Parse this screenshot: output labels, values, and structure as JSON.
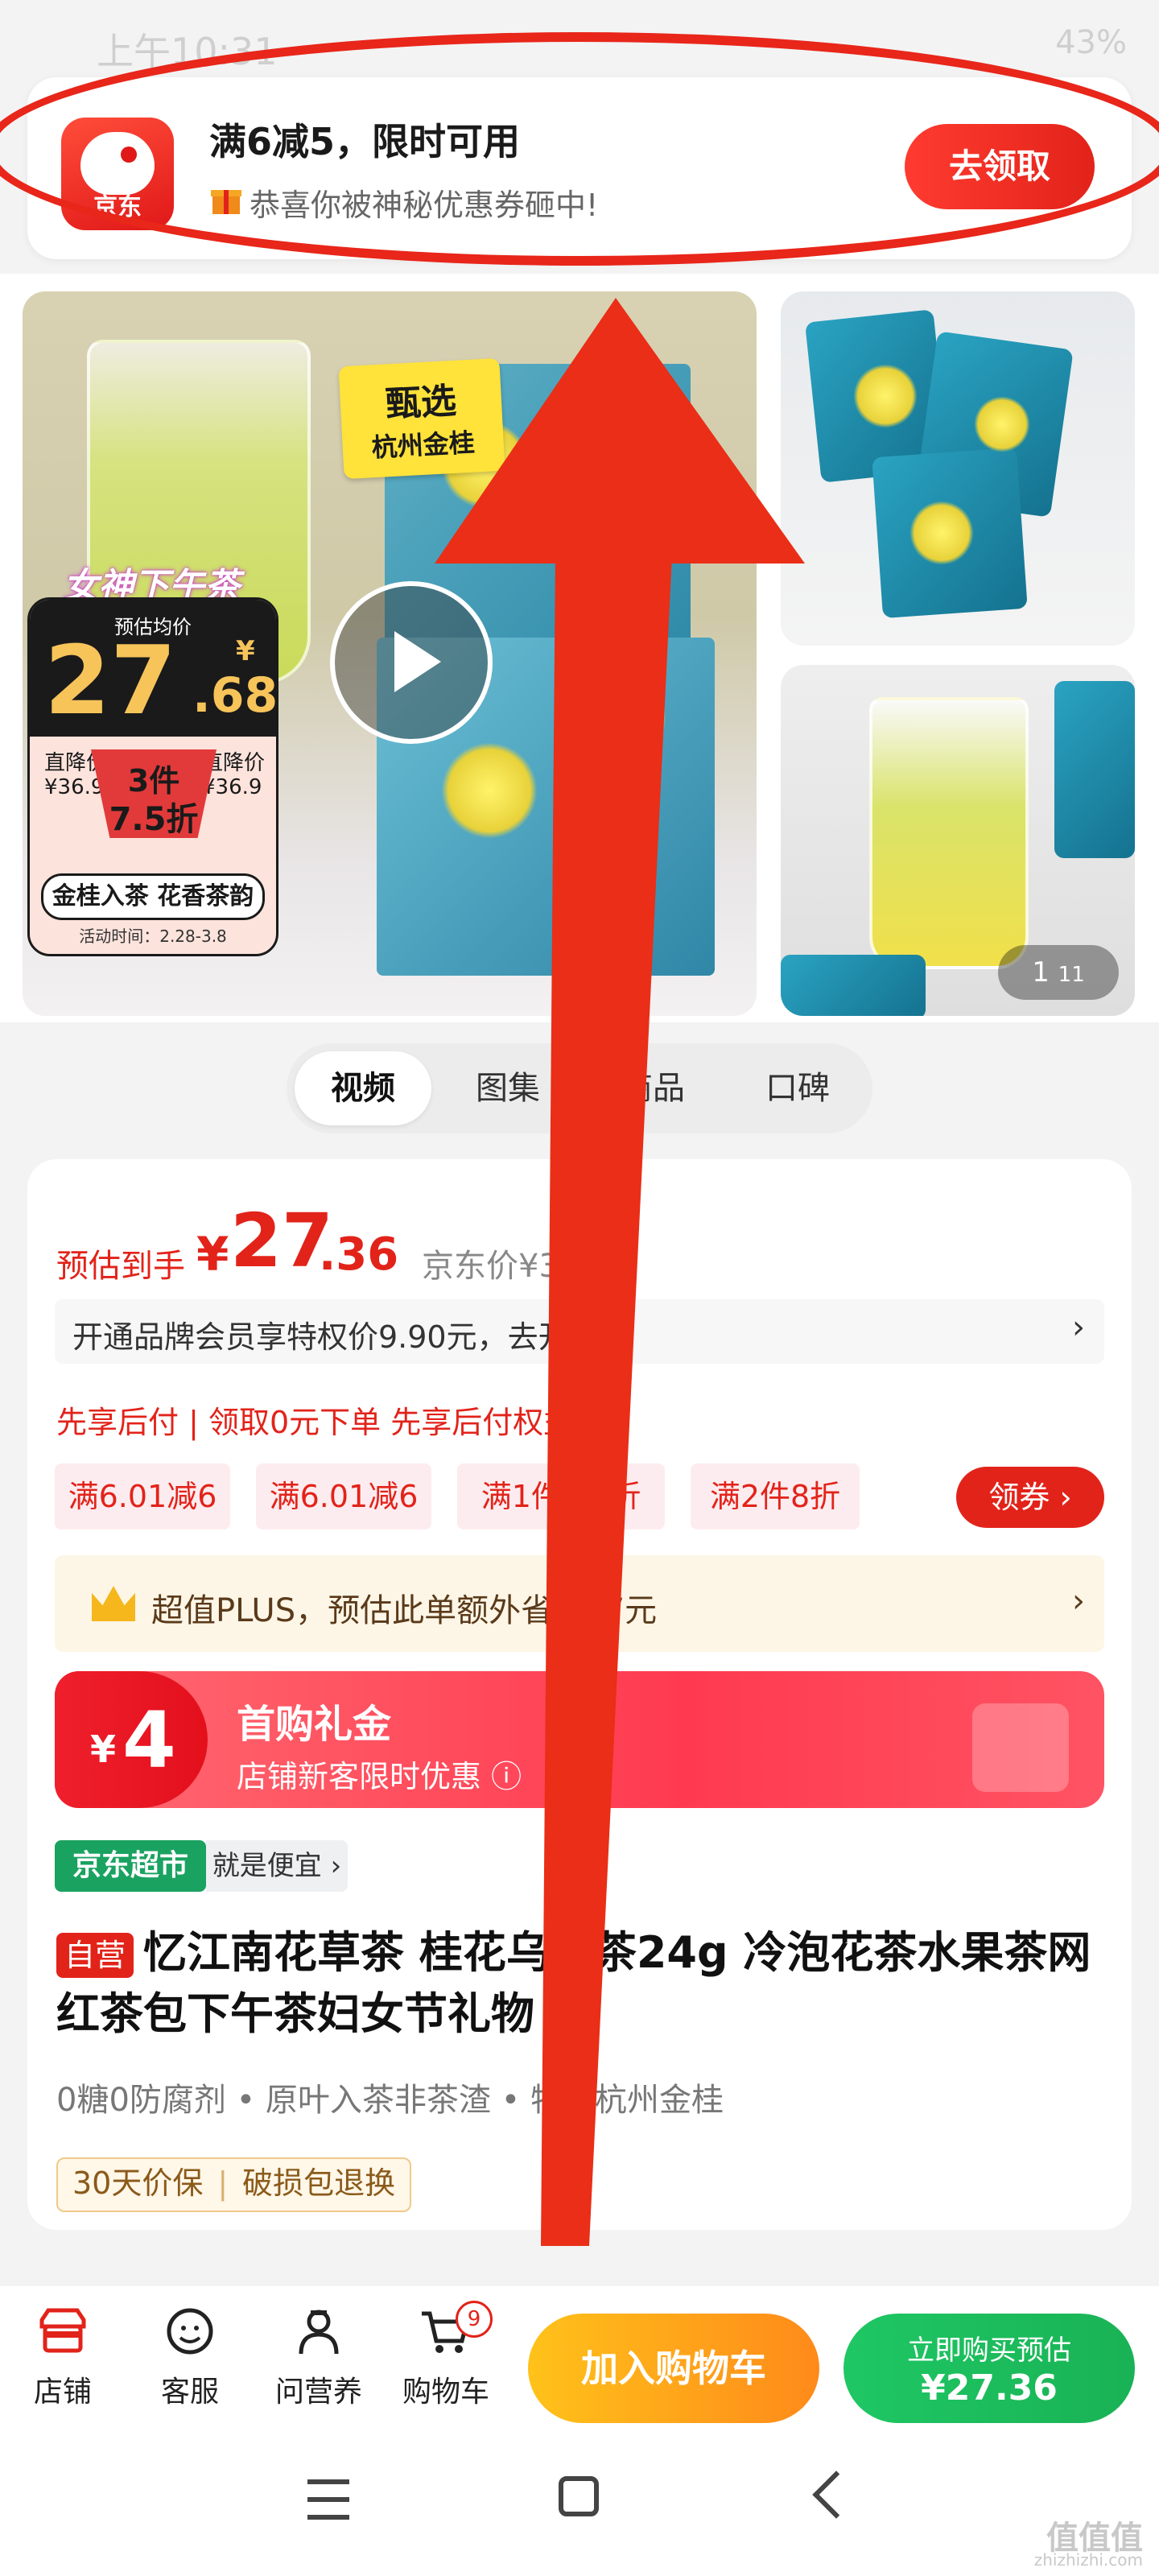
{
  "status_bar": {
    "time": "上午10:31",
    "battery": "43%"
  },
  "notification": {
    "app_logo_text": "京东",
    "title": "满6减5，限时可用",
    "subtitle": "恭喜你被神秘优惠券砸中!",
    "button": "去领取"
  },
  "gallery": {
    "tag_line1": "甄选",
    "tag_line2": "杭州金桂",
    "goddess_text": "女神下午茶",
    "price_label": "预估均价",
    "price_int": "27",
    "price_dec": ".68",
    "price_yen": "¥",
    "left_price": "直降价\n¥36.9",
    "right_price": "直降价\n¥36.9",
    "discount_line1": "3件",
    "discount_line2": "7.5折",
    "slogan": "金桂入茶 花香茶韵",
    "activity": "活动时间：2.28-3.8",
    "pager_current": "1",
    "pager_total": "11"
  },
  "tabs": [
    "视频",
    "图集",
    "商品",
    "口碑"
  ],
  "price": {
    "est_label": "预估到手",
    "yen": "¥",
    "int": "27",
    "dec": ".36",
    "jd_price": "京东价¥36.90"
  },
  "member": {
    "text": "开通品牌会员享特权价9.90元，去开通",
    "arrow": "›"
  },
  "pay_later": "先享后付 | 领取0元下单 先享后付权益 ›",
  "coupons": [
    "满6.01减6",
    "满6.01减6",
    "满1件9.5折",
    "满2件8折"
  ],
  "get_coupon": "领券 ›",
  "plus": {
    "text": "超值PLUS，预估此单额外省0.37元",
    "arrow": "›"
  },
  "first_buy": {
    "yen": "¥",
    "amount": "4",
    "title": "首购礼金",
    "subtitle": "店铺新客限时优惠 ⓘ"
  },
  "supermarket": {
    "badge": "京东超市",
    "tagline": "就是便宜 ›"
  },
  "product": {
    "self_badge": "自营",
    "title": "忆江南花草茶 桂花乌龙茶24g 冷泡花茶水果茶网红茶包下午茶妇女节礼物 ⌄"
  },
  "features": "0糖0防腐剂 • 原叶入茶非茶渣 • 特加杭州金桂",
  "guarantees": [
    "30天价保",
    "破损包退换"
  ],
  "bottom_bar": {
    "items": [
      {
        "label": "店铺",
        "icon": "store-icon"
      },
      {
        "label": "客服",
        "icon": "customer-service-icon"
      },
      {
        "label": "问营养",
        "icon": "nutritionist-icon"
      },
      {
        "label": "购物车",
        "icon": "cart-icon"
      }
    ],
    "cart_count": "9",
    "add_to_cart": "加入购物车",
    "buy_now_line1": "立即购买预估",
    "buy_now_line2": "¥27.36"
  },
  "watermark": {
    "main": "值值值",
    "sub": "zhizhizhi.com"
  },
  "colors": {
    "jd_red": "#e2231a",
    "annotation_red": "#e8261a",
    "buy_green": "#1fc764",
    "cart_orange": "#ff9a1a"
  }
}
